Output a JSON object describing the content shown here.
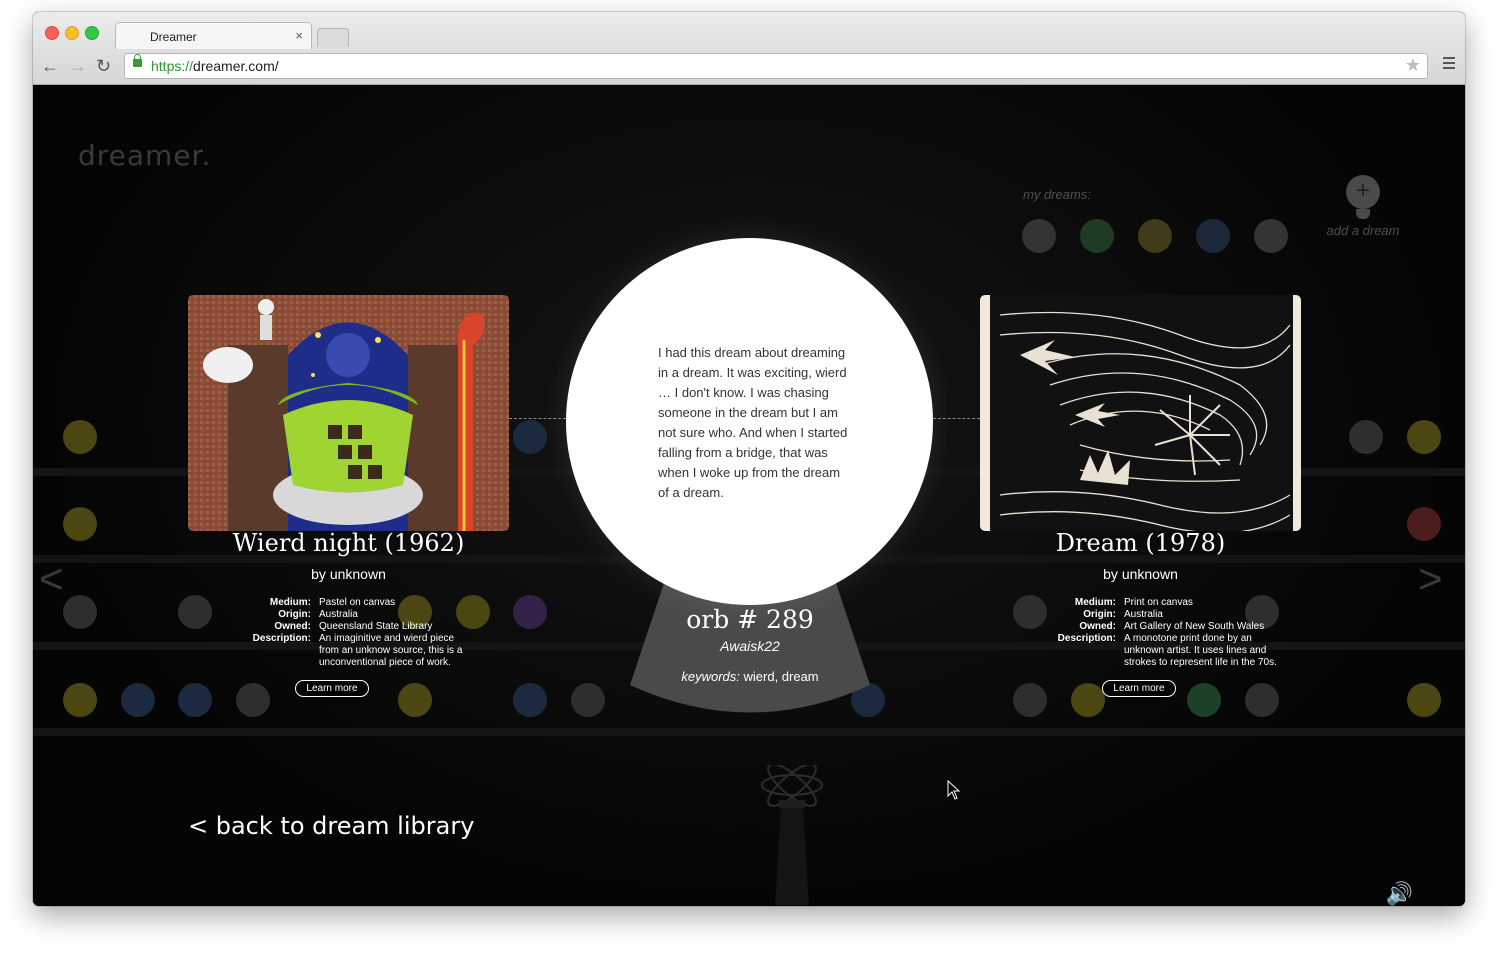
{
  "browser": {
    "tab_title": "Dreamer",
    "tab_close": "×",
    "url_scheme": "https://",
    "url_rest": "dreamer.com/",
    "back_icon": "←",
    "forward_icon": "→",
    "reload_icon": "↻",
    "star_icon": "★"
  },
  "page": {
    "logo": "dreamer.",
    "my_dreams_label": "my dreams:",
    "add_dream_icon": "+",
    "add_dream_label": "add a dream",
    "back_link": "< back to dream library",
    "prev_arrow": "<",
    "next_arrow": ">",
    "sound_icon": "🔊"
  },
  "orb": {
    "dream_text": "I had this dream about dreaming in a dream. It was exciting, wierd … I don't know. I was chasing someone in the dream but I am not sure who. And when I started falling from a bridge, that was when I woke up from the dream of a dream.",
    "number": "orb # 289",
    "user": "Awaisk22",
    "keywords_label": "keywords:",
    "keywords": "wierd, dream"
  },
  "left_art": {
    "title": "Wierd night (1962)",
    "by": "by unknown",
    "medium_label": "Medium:",
    "medium": "Pastel on canvas",
    "origin_label": "Origin:",
    "origin": "Australia",
    "owned_label": "Owned:",
    "owned": "Queensland State Library",
    "description_label": "Description:",
    "description": "An imaginitive and wierd piece from an unknow source, this is a unconventional piece of work.",
    "learn_more": "Learn more"
  },
  "right_art": {
    "title": "Dream (1978)",
    "by": "by unknown",
    "medium_label": "Medium:",
    "medium": "Print on canvas",
    "origin_label": "Origin:",
    "origin": "Australia",
    "owned_label": "Owned:",
    "owned": "Art Gallery of New South Wales",
    "description_label": "Description:",
    "description": "A monotone print done by an unknown artist. It uses lines and strokes to represent life in the 70s.",
    "learn_more": "Learn more"
  },
  "colors": {
    "background": "#050505",
    "orb": "#ffffff",
    "cone": "#4a4a4a",
    "url_scheme": "#2c9a2c"
  }
}
